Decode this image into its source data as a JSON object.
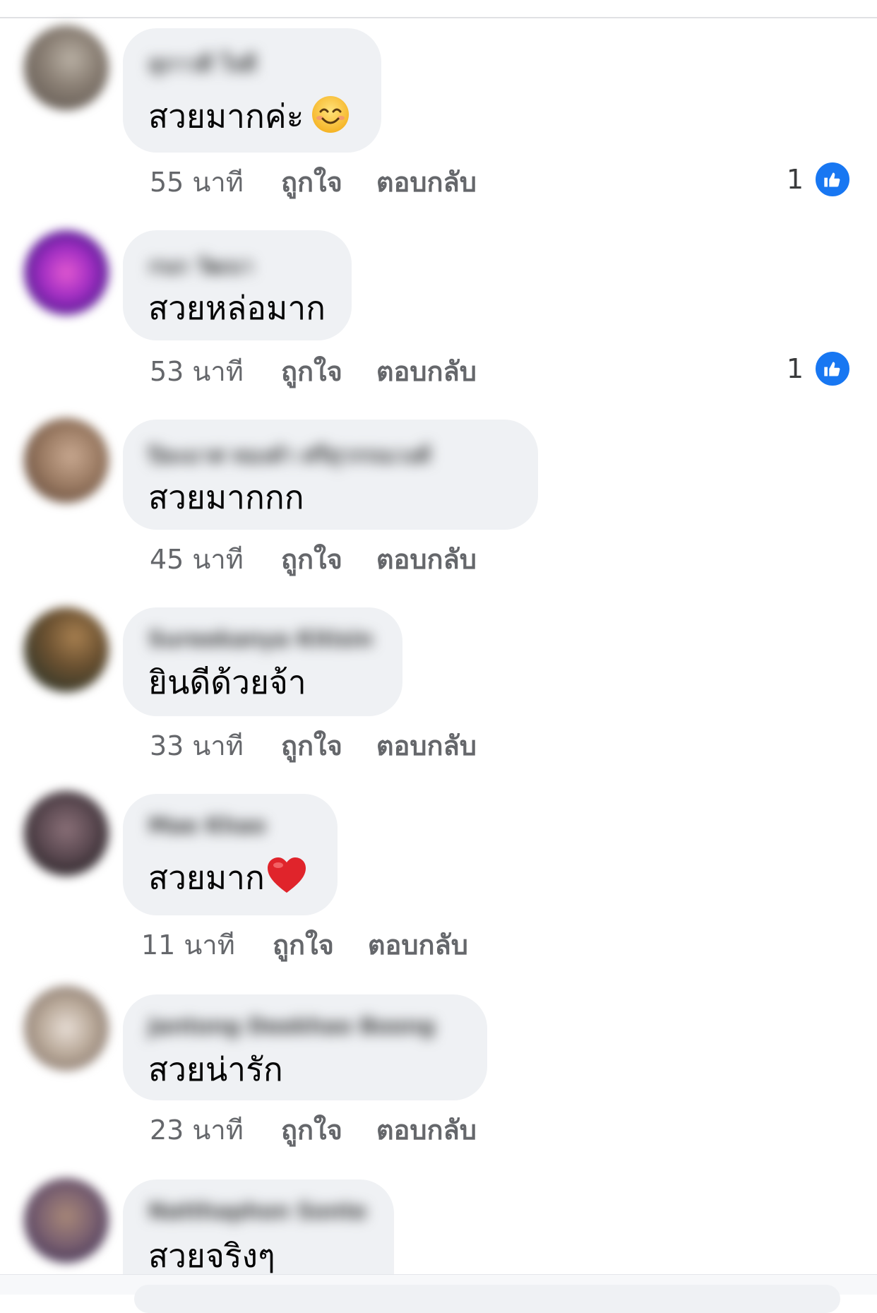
{
  "comments": [
    {
      "author": "สุภาวดี ใจดี",
      "text": "สวยมากค่ะ",
      "emoji": "smiling-face",
      "time": "55 นาที",
      "like_label": "ถูกใจ",
      "reply_label": "ตอบกลับ",
      "reaction_count": "1",
      "avatar_colors": [
        "#6b625a",
        "#b9b0a4"
      ]
    },
    {
      "author": "กนก วัฒนา",
      "text": "สวยหล่อมาก",
      "time": "53 นาที",
      "like_label": "ถูกใจ",
      "reply_label": "ตอบกลับ",
      "reaction_count": "1",
      "avatar_colors": [
        "#4b1a8c",
        "#d23cc7"
      ]
    },
    {
      "author": "ปิยะมาศ ทองคำ ศรีสุวรรณวงศ์",
      "text": "สวยมากกก",
      "time": "45 นาที",
      "like_label": "ถูกใจ",
      "reply_label": "ตอบกลับ",
      "avatar_colors": [
        "#7a5a44",
        "#b89a80"
      ]
    },
    {
      "author": "Sureekanya Kitisin",
      "text": "ยินดีด้วยจ้า",
      "time": "33 นาที",
      "like_label": "ถูกใจ",
      "reply_label": "ตอบกลับ",
      "avatar_colors": [
        "#3a3a2a",
        "#8a6a3a"
      ]
    },
    {
      "author": "Mae Khao",
      "text": "สวยมาก",
      "emoji": "red-heart",
      "time": "11 นาที",
      "like_label": "ถูกใจ",
      "reply_label": "ตอบกลับ",
      "avatar_colors": [
        "#2a2428",
        "#6a5a60"
      ]
    },
    {
      "author": "Jantong Deekhao Boong",
      "text": "สวยน่ารัก",
      "time": "23 นาที",
      "like_label": "ถูกใจ",
      "reply_label": "ตอบกลับ",
      "avatar_colors": [
        "#8a7a70",
        "#d8ccc4"
      ]
    },
    {
      "author": "Natthaphon Sonte",
      "text": "สวยจริงๆ",
      "avatar_colors": [
        "#4a3a5a",
        "#9a7a6a"
      ]
    }
  ],
  "colors": {
    "bubble": "#eff1f4",
    "meta_text": "#65676b",
    "like_badge": "#1877f2"
  }
}
